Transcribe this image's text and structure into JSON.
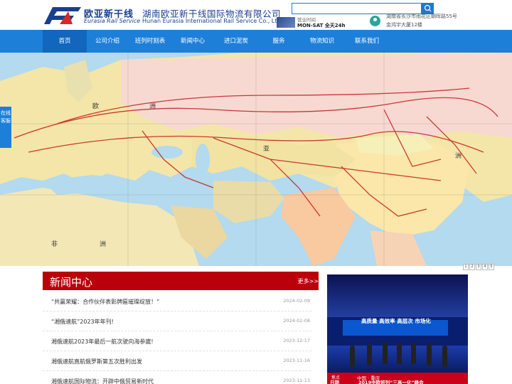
{
  "brand": {
    "name_cn": "欧亚新干线",
    "name_en": "Eurasia Rail Service",
    "company_cn": "湖南欧亚新干线国际物流有限公司",
    "company_en": "Hunan Eurasia International Rail Service Co., Ltd"
  },
  "header": {
    "search_placeholder": "",
    "hours_label": "营业时间",
    "hours_value": "MON-SAT 全天24h",
    "address_line1": "湖南省长沙市雨花区朝晖路55号",
    "address_line2": "金鸿宇大厦12楼"
  },
  "nav": {
    "items": [
      {
        "label": "首页"
      },
      {
        "label": "公司介绍"
      },
      {
        "label": "班列时刻表"
      },
      {
        "label": "新闻中心"
      },
      {
        "label": "进口泥炭"
      },
      {
        "label": "服务"
      },
      {
        "label": "物流知识"
      },
      {
        "label": "联系我们"
      }
    ]
  },
  "banner": {
    "side_tab": "在线客服",
    "pages": [
      "1",
      "2",
      "3",
      "4",
      "5"
    ],
    "map_labels": {
      "europe": "欧",
      "europe2": "洲",
      "asia": "亚",
      "asia2": "洲",
      "africa": "非",
      "africa2": "洲"
    }
  },
  "news": {
    "title": "新闻中心",
    "more": "更多>>",
    "items": [
      {
        "text": "“共赢荣耀：合作伙伴表彰牌匾璀璨绽放！”",
        "date": "2024-02-09"
      },
      {
        "text": "“湘俄速航”2023年年刊!",
        "date": "2024-02-08"
      },
      {
        "text": "湘俄速航2023年最后一航次驶向海参崴!",
        "date": "2023-12-17"
      },
      {
        "text": "湘俄速航直航俄罗斯第五次胜利出发",
        "date": "2023-11-16"
      },
      {
        "text": "湘俄速航国际物流：开辟中俄贸易新时代",
        "date": "2023-11-13"
      }
    ]
  },
  "photo": {
    "slogan": "高质量 高效率 高层次 市场化",
    "caption_tag": "焦点",
    "caption": "中国 · 重庆",
    "year_label": "日期",
    "subtitle": "2019中欧班列“三高一化”峰会"
  },
  "colors": {
    "nav": "#1e7fd9",
    "news_head": "#b9000b",
    "brand": "#1a3f8f"
  }
}
